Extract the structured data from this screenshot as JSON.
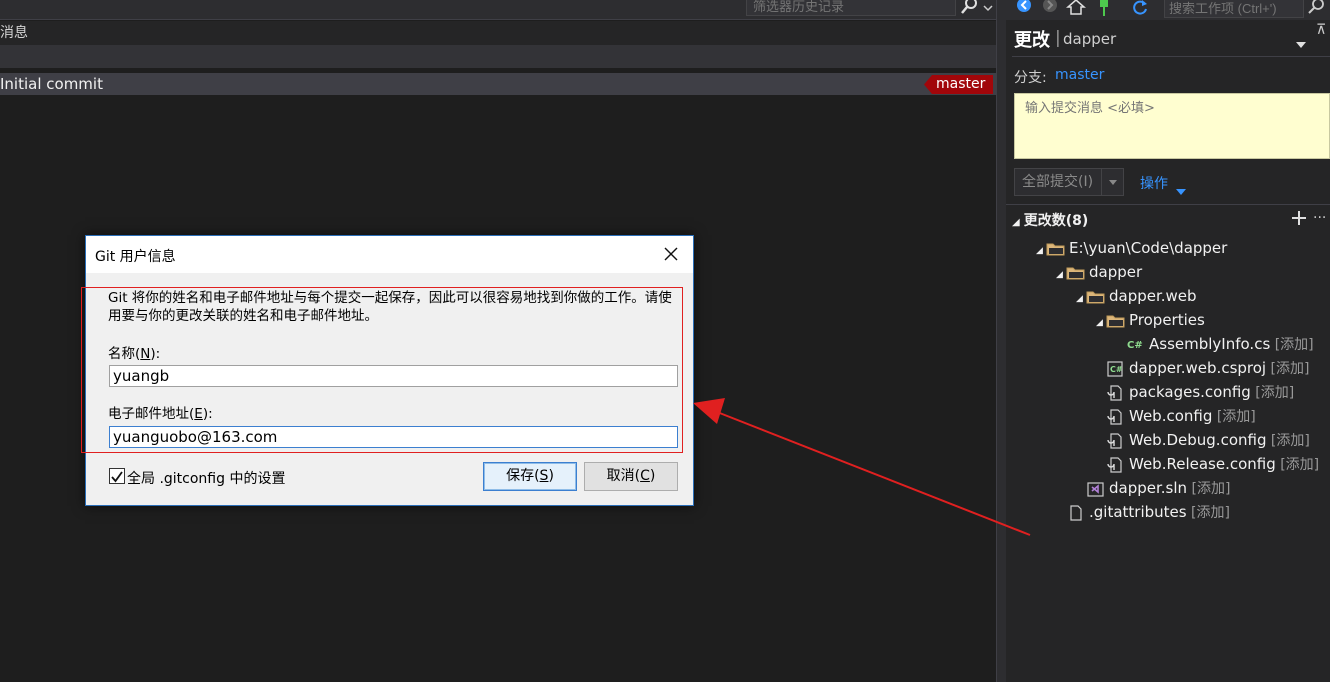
{
  "history": {
    "search_placeholder": "筛选器历史记录",
    "column_message": "消息",
    "commits": [
      {
        "message": "Initial commit",
        "branch": "master"
      }
    ]
  },
  "team_explorer": {
    "search_placeholder": "搜索工作项 (Ctrl+')",
    "title": "更改",
    "separator": "|",
    "repo": "dapper",
    "edge_glyph": "⊼",
    "branch_label": "分支:",
    "branch": "master",
    "commit_message_placeholder": "输入提交消息 <必填>",
    "commit_all_label": "全部提交(I)",
    "actions_label": "操作",
    "changes_header": "更改数(8)",
    "more_glyph": "···",
    "tree": [
      {
        "label": "E:\\yuan\\Code\\dapper",
        "tag": "",
        "icon": "folder-icon",
        "depth": 0,
        "expanded": true
      },
      {
        "label": "dapper",
        "tag": "",
        "icon": "folder-icon",
        "depth": 1,
        "expanded": true
      },
      {
        "label": "dapper.web",
        "tag": "",
        "icon": "folder-icon",
        "depth": 2,
        "expanded": true
      },
      {
        "label": "Properties",
        "tag": "",
        "icon": "folder-icon",
        "depth": 3,
        "expanded": true
      },
      {
        "label": "AssemblyInfo.cs",
        "tag": "[添加]",
        "icon": "csharp-file-icon",
        "depth": 4,
        "expanded": false
      },
      {
        "label": "dapper.web.csproj",
        "tag": "[添加]",
        "icon": "csproj-file-icon",
        "depth": 3,
        "expanded": false
      },
      {
        "label": "packages.config",
        "tag": "[添加]",
        "icon": "config-file-icon",
        "depth": 3,
        "expanded": false
      },
      {
        "label": "Web.config",
        "tag": "[添加]",
        "icon": "config-file-icon",
        "depth": 3,
        "expanded": false
      },
      {
        "label": "Web.Debug.config",
        "tag": "[添加]",
        "icon": "config-file-icon",
        "depth": 3,
        "expanded": false
      },
      {
        "label": "Web.Release.config",
        "tag": "[添加]",
        "icon": "config-file-icon",
        "depth": 3,
        "expanded": false
      },
      {
        "label": "dapper.sln",
        "tag": "[添加]",
        "icon": "solution-file-icon",
        "depth": 2,
        "expanded": false
      },
      {
        "label": ".gitattributes",
        "tag": "[添加]",
        "icon": "generic-file-icon",
        "depth": 1,
        "expanded": false
      }
    ]
  },
  "dialog": {
    "title": "Git 用户信息",
    "description": "Git 将你的姓名和电子邮件地址与每个提交一起保存，因此可以很容易地找到你做的工作。请使用要与你的更改关联的姓名和电子邮件地址。",
    "name_label_prefix": "名称(",
    "name_label_key": "N",
    "name_label_suffix": "):",
    "name_value": "yuangb",
    "email_label_prefix": "电子邮件地址(",
    "email_label_key": "E",
    "email_label_suffix": "):",
    "email_value": "yuanguobo@163.com",
    "global_checkbox_label": "全局 .gitconfig 中的设置",
    "global_checked": true,
    "save_prefix": "保存(",
    "save_key": "S",
    "save_suffix": ")",
    "cancel_prefix": "取消(",
    "cancel_key": "C",
    "cancel_suffix": ")"
  },
  "colors": {
    "accent": "#3794ff",
    "branch_tag": "#a1060a",
    "annotation": "#e02020",
    "commit_box": "#fffed0"
  }
}
